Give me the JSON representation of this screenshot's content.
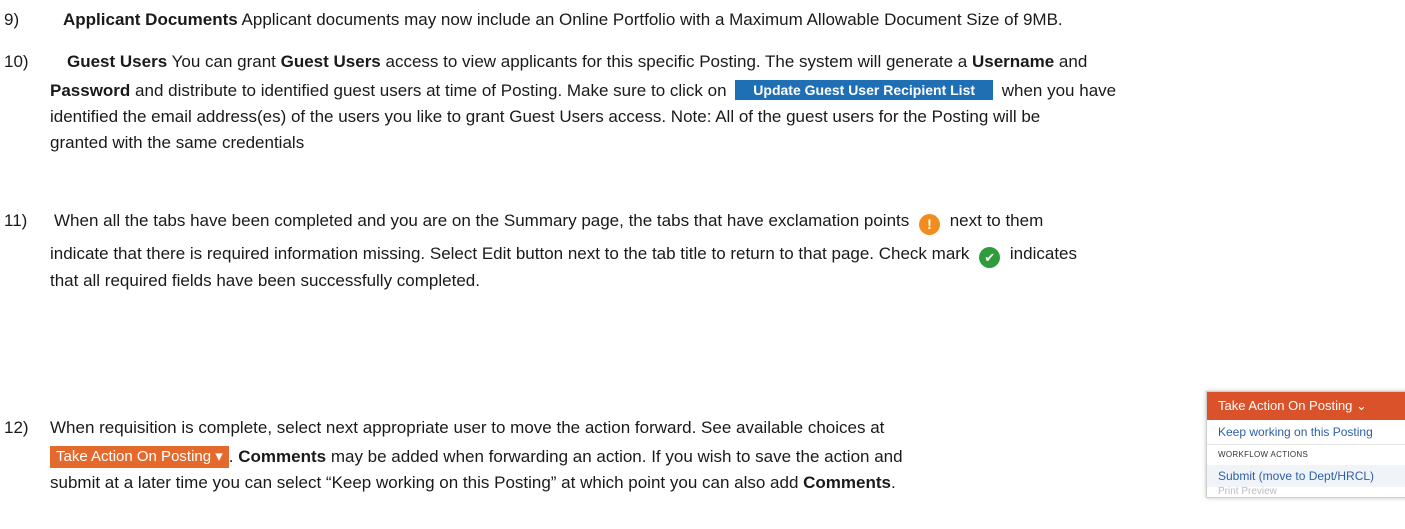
{
  "items": [
    {
      "num": "9)",
      "parts": [
        "Applicant Documents",
        " Applicant documents may now include an Online Portfolio with a Maximum Allowable Document Size of 9MB."
      ]
    },
    {
      "num": "10)",
      "bold1": "Guest Users",
      "t1": " You can grant ",
      "bold2": "Guest Users",
      "t2": " access to view applicants for this specific Posting. The system will generate a ",
      "bold3": "Username",
      "t3": " and",
      "bold4": "Password",
      "t4": " and distribute to identified guest users at time of Posting. Make sure to click on ",
      "button": "Update Guest User Recipient List",
      "t5": " when you have",
      "t6": "identified the email address(es) of the users you like to grant Guest Users access. Note: All of the guest users for the Posting will be",
      "t7": "granted with the same credentials"
    },
    {
      "num": "11)",
      "t1": "When all the tabs have been completed and you are on the Summary page, the tabs that have exclamation points ",
      "t2": " next to them",
      "t3": "indicate that there is required information missing. Select Edit button next to the tab title to return to that page. Check mark ",
      "t4": " indicates",
      "t5": "that all required fields have been successfully completed."
    },
    {
      "num": "12)",
      "t1": "When requisition is complete, select next appropriate user to move the action forward. See available choices at",
      "button": "Take Action On Posting",
      "t2": ". ",
      "bold1": "Comments",
      "t3": " may be added when forwarding an action. If you wish to save the action and",
      "t4": "submit at a later time you can select “Keep working on this Posting” at which point you can also add ",
      "bold2": "Comments",
      "t5": "."
    }
  ],
  "menu": {
    "title": "Take Action On Posting",
    "keep": "Keep working on this Posting",
    "section": "WORKFLOW ACTIONS",
    "submit": "Submit (move to Dept/HRCL)",
    "ghost": "Print Preview"
  },
  "icons": {
    "exclamation": "exclamation-circle-icon",
    "check": "check-circle-icon",
    "chevron": "chevron-down-icon",
    "caret": "caret-down-icon"
  },
  "colors": {
    "button_blue": "#1f6fb5",
    "button_orange": "#e36a2c",
    "menu_header": "#d9522a",
    "warning": "#f18d1f",
    "success": "#2e9c3c"
  }
}
